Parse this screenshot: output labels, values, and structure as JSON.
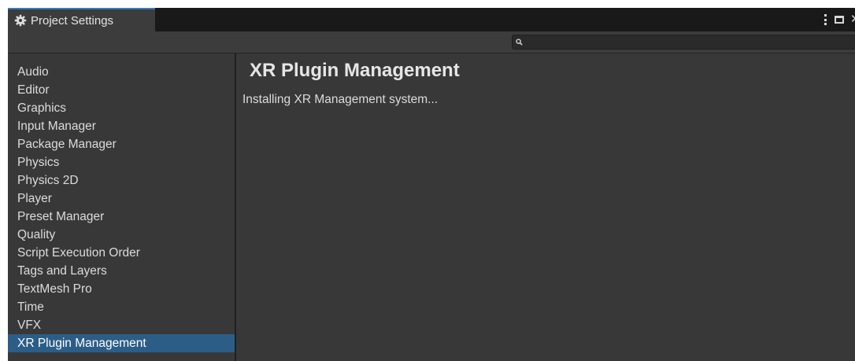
{
  "window": {
    "tab_title": "Project Settings",
    "tab_icon": "gear-icon",
    "controls": {
      "menu_icon": "kebab-menu-icon",
      "maximize_icon": "maximize-icon",
      "close_icon": "close-icon",
      "close_glyph": "✕"
    }
  },
  "search": {
    "icon": "search-icon",
    "icon_glyph": "🔍",
    "value": "",
    "placeholder": ""
  },
  "sidebar": {
    "items": [
      {
        "label": "Audio"
      },
      {
        "label": "Editor"
      },
      {
        "label": "Graphics"
      },
      {
        "label": "Input Manager"
      },
      {
        "label": "Package Manager"
      },
      {
        "label": "Physics"
      },
      {
        "label": "Physics 2D"
      },
      {
        "label": "Player"
      },
      {
        "label": "Preset Manager"
      },
      {
        "label": "Quality"
      },
      {
        "label": "Script Execution Order"
      },
      {
        "label": "Tags and Layers"
      },
      {
        "label": "TextMesh Pro"
      },
      {
        "label": "Time"
      },
      {
        "label": "VFX"
      },
      {
        "label": "XR Plugin Management"
      }
    ],
    "selected_index": 15
  },
  "main": {
    "title": "XR Plugin Management",
    "status": "Installing XR Management system..."
  },
  "colors": {
    "window_bg": "#383838",
    "tab_accent": "#3a79bb",
    "selection": "#2c5d87",
    "text": "#dcdcdc"
  }
}
